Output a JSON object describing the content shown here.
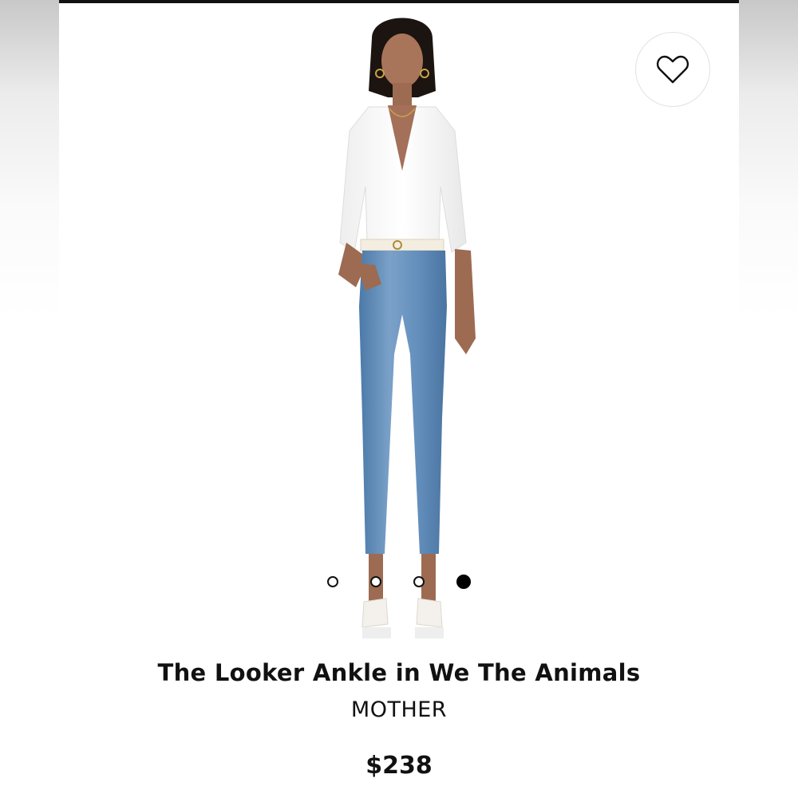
{
  "product": {
    "title": "The Looker Ankle in We The Animals",
    "brand": "MOTHER",
    "price": "$238"
  },
  "image": {
    "description_icon": "model-photo"
  },
  "favorite": {
    "icon": "heart-outline-icon"
  },
  "carousel": {
    "total": 4,
    "active_index": 3
  },
  "colors": {
    "text": "#111111",
    "denim": "#5b86b3",
    "shirt": "#ffffff",
    "accent": "#000000"
  }
}
